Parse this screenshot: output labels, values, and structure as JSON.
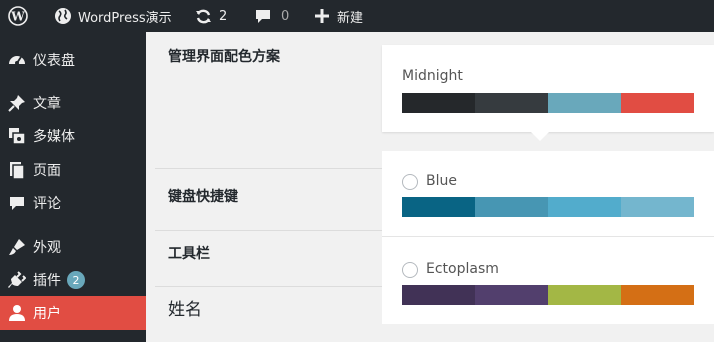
{
  "adminbar": {
    "wp_logo_icon": "wordpress-logo-icon",
    "site_icon": "globe-icon",
    "site_name": "WordPress演示",
    "updates_icon": "refresh-icon",
    "updates_count": "2",
    "comments_icon": "comment-bubble-icon",
    "comments_count": "0",
    "new_icon": "plus-icon",
    "new_label": "新建"
  },
  "sidebar": {
    "items": [
      {
        "label": "仪表盘",
        "icon": "dashboard-icon"
      },
      {
        "label": "文章",
        "icon": "pushpin-icon"
      },
      {
        "label": "多媒体",
        "icon": "media-icon"
      },
      {
        "label": "页面",
        "icon": "pages-icon"
      },
      {
        "label": "评论",
        "icon": "comment-icon"
      },
      {
        "label": "外观",
        "icon": "appearance-brush-icon"
      },
      {
        "label": "插件",
        "icon": "plugin-icon",
        "badge": "2"
      },
      {
        "label": "用户",
        "icon": "user-icon",
        "active": true
      }
    ],
    "active_color": "#e14d43",
    "badge_color": "#69a8bb"
  },
  "settings": {
    "color_scheme_label": "管理界面配色方案",
    "keyboard_shortcuts_label": "键盘快捷键",
    "toolbar_label": "工具栏",
    "name_heading": "姓名"
  },
  "color_schemes": [
    {
      "name": "Midnight",
      "selected": true,
      "colors": [
        "#25282b",
        "#363b3f",
        "#69a8bb",
        "#e14d43"
      ]
    },
    {
      "name": "Blue",
      "selected": false,
      "colors": [
        "#096484",
        "#4796b3",
        "#52accc",
        "#74b6ce"
      ]
    },
    {
      "name": "Ectoplasm",
      "selected": false,
      "colors": [
        "#413256",
        "#523f6d",
        "#a3b745",
        "#d46f15"
      ]
    }
  ]
}
